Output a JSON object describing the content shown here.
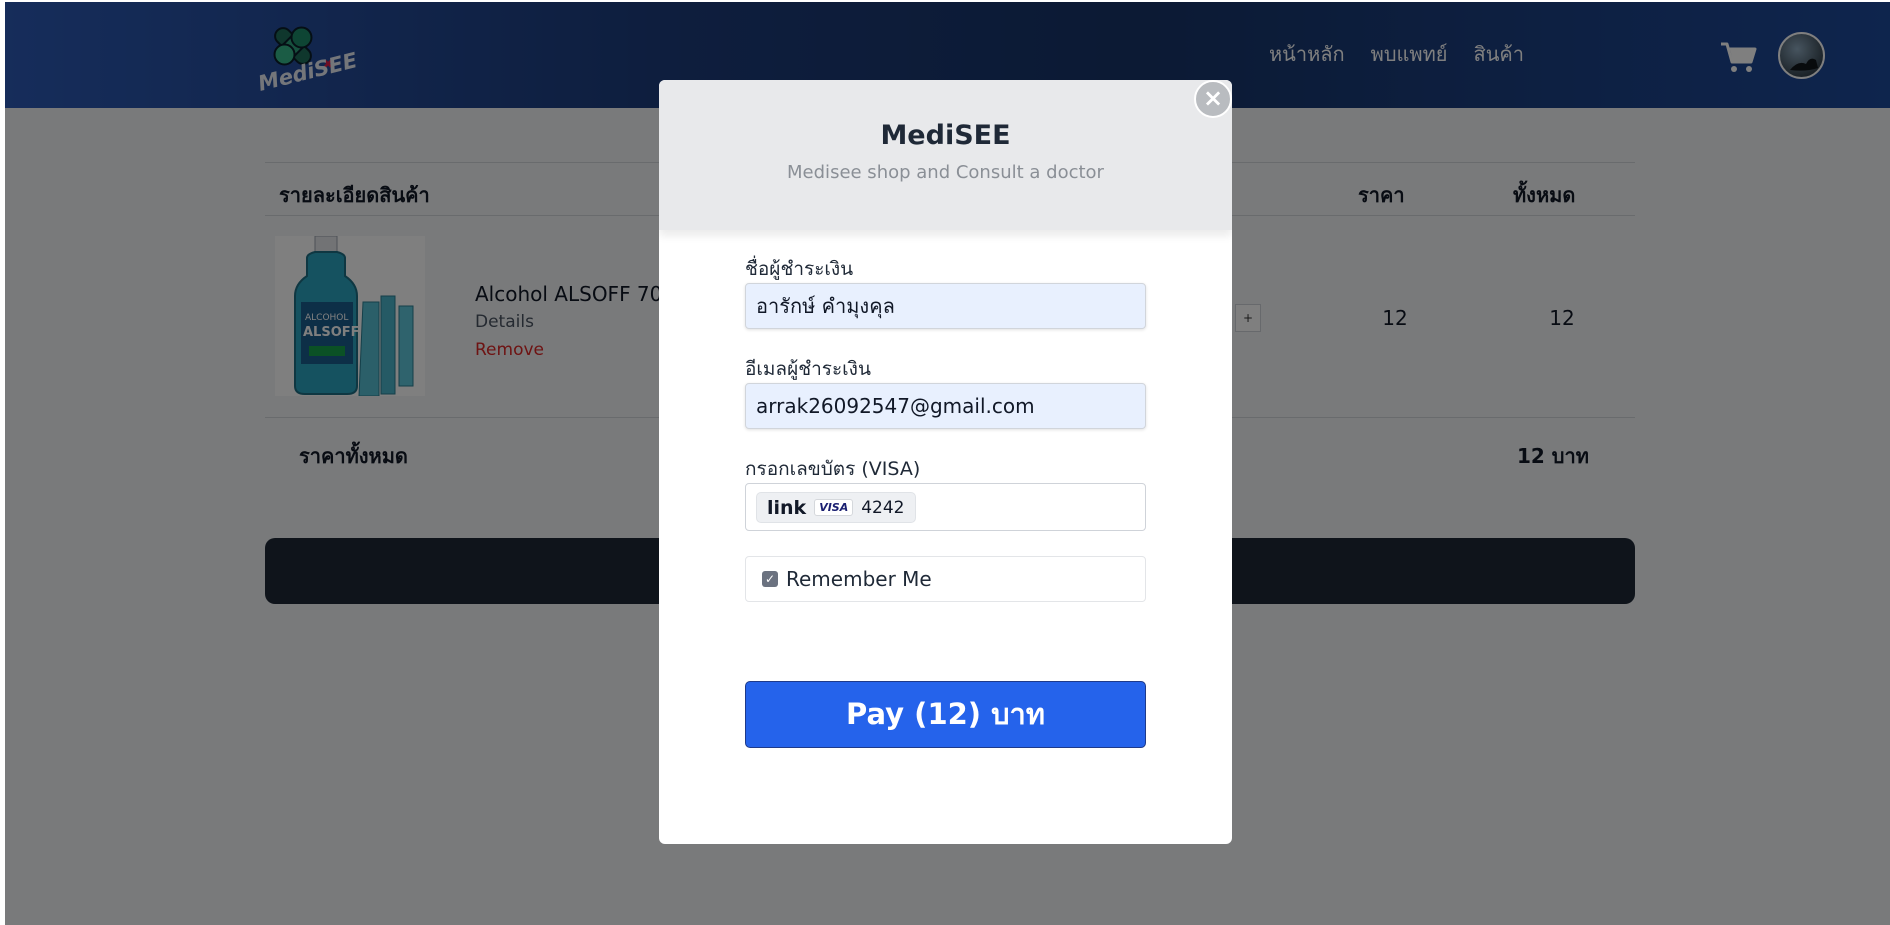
{
  "brand": {
    "logo_text": "MediSEE"
  },
  "nav": {
    "links": [
      "หน้าหลัก",
      "พบแพทย์",
      "สินค้า"
    ],
    "cart_icon": "shopping-cart-icon",
    "avatar_icon": "user-avatar"
  },
  "cart": {
    "headers": {
      "details": "รายละเอียดสินค้า",
      "price": "ราคา",
      "total": "ทั้งหมด"
    },
    "item": {
      "name": "Alcohol ALSOFF 70",
      "details": "Details",
      "remove": "Remove",
      "qty_plus": "+",
      "price": "12",
      "total": "12"
    },
    "summary": {
      "label": "ราคาทั้งหมด",
      "value": "12 บาท"
    }
  },
  "modal": {
    "title": "MediSEE",
    "subtitle": "Medisee shop and Consult a doctor",
    "close": "×",
    "name_label": "ชื่อผู้ชำระเงิน",
    "name_value": "อารักษ์ คำมุงคุล",
    "email_label": "อีเมลผู้ชำระเงิน",
    "email_value": "arrak26092547@gmail.com",
    "card_label": "กรอกเลขบัตร (VISA)",
    "card_link": "link",
    "card_brand": "VISA",
    "card_last4": "4242",
    "remember_label": "Remember Me",
    "remember_checked": true,
    "pay_label": "Pay (12) บาท"
  },
  "colors": {
    "nav_start": "#2c5ab6",
    "nav_end": "#183468",
    "pay_button": "#2563eb",
    "remove_text": "#dc2626",
    "checkout_bar": "#1f2937"
  }
}
